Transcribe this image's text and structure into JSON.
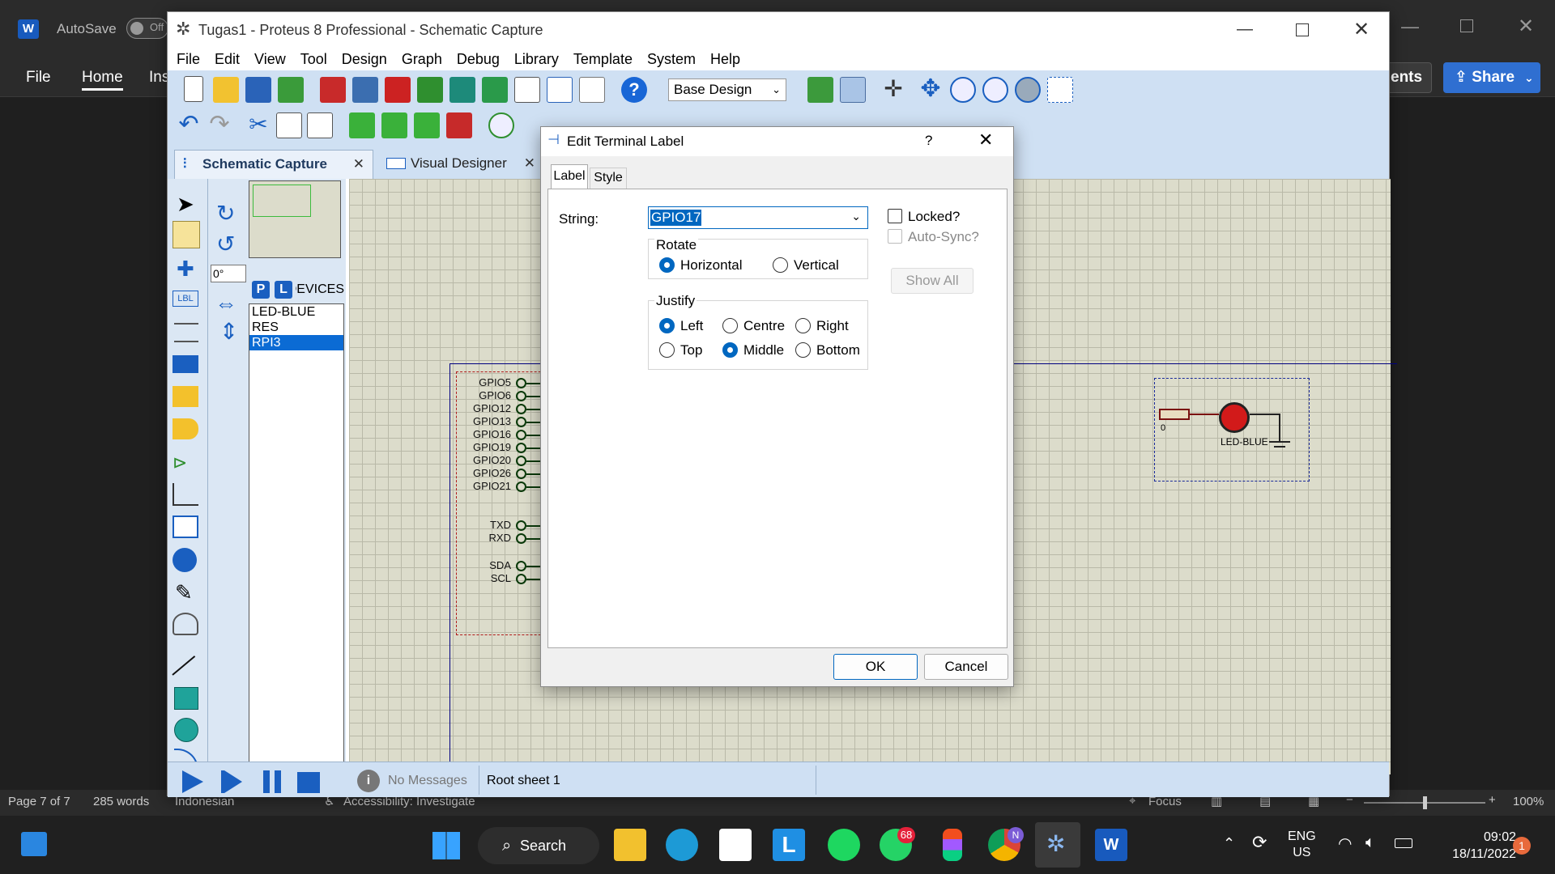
{
  "word": {
    "autosave_label": "AutoSave",
    "autosave_state": "Off",
    "ribbon_tabs": [
      "File",
      "Home",
      "Ins"
    ],
    "comments_label": "ents",
    "share_label": "Share",
    "status_page": "Page 7 of 7",
    "status_words": "285 words",
    "status_lang": "Indonesian",
    "status_accessibility": "Accessibility: Investigate",
    "status_focus": "Focus",
    "status_zoom": "100%"
  },
  "proteus": {
    "title": "Tugas1 - Proteus 8 Professional - Schematic Capture",
    "menu": [
      "File",
      "Edit",
      "View",
      "Tool",
      "Design",
      "Graph",
      "Debug",
      "Library",
      "Template",
      "System",
      "Help"
    ],
    "variant_select": "Base Design",
    "tabs": [
      {
        "label": "Schematic Capture"
      },
      {
        "label": "Visual Designer"
      }
    ],
    "rotation": "0°",
    "devices_header": "DEVICES",
    "device_buttons": [
      "P",
      "L"
    ],
    "devices": [
      "LED-BLUE",
      "RES",
      "RPI3"
    ],
    "selected_device": "RPI3",
    "status_messages": "No Messages",
    "status_sheet": "Root sheet 1",
    "schematic": {
      "gpio_pins": [
        "GPIO5",
        "GPIO6",
        "GPIO12",
        "GPIO13",
        "GPIO16",
        "GPIO19",
        "GPIO20",
        "GPIO26",
        "GPIO21"
      ],
      "uart_pins": [
        "TXD",
        "RXD"
      ],
      "i2c_pins": [
        "SDA",
        "SCL"
      ],
      "led_label": "LED-BLUE",
      "res_value_fragment": "0"
    }
  },
  "dialog": {
    "title": "Edit Terminal Label",
    "help": "?",
    "tabs": [
      "Label",
      "Style"
    ],
    "string_label": "String:",
    "string_value": "GPIO17",
    "locked_label": "Locked?",
    "autosync_label": "Auto-Sync?",
    "show_all": "Show All",
    "rotate_label": "Rotate",
    "rotate_options": [
      "Horizontal",
      "Vertical"
    ],
    "rotate_selected": "Horizontal",
    "justify_label": "Justify",
    "justify_options": [
      "Left",
      "Centre",
      "Right",
      "Top",
      "Middle",
      "Bottom"
    ],
    "justify_selected": [
      "Left",
      "Middle"
    ],
    "ok": "OK",
    "cancel": "Cancel"
  },
  "taskbar": {
    "search": "Search",
    "whatsapp_badge": "68",
    "chrome_badge": "N",
    "lang_line1": "ENG",
    "lang_line2": "US",
    "time": "09:02",
    "date": "18/11/2022",
    "notification_count": "1"
  }
}
